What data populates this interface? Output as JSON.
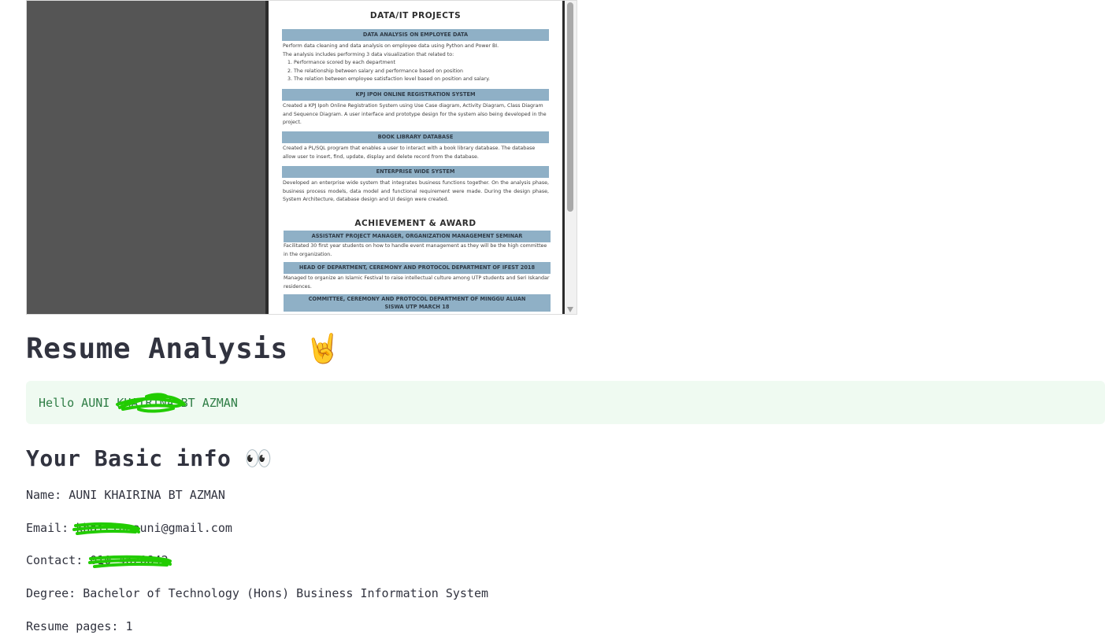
{
  "pdf": {
    "projects_title": "DATA/IT  PROJECTS",
    "p1": {
      "heading": "DATA ANALYSIS ON EMPLOYEE DATA",
      "line1": "Perform data cleaning and data analysis on employee data using Python and Power BI.",
      "line2": "The analysis includes performing 3 data visualization that related to:",
      "items": [
        "1. Performance scored by each department",
        "2. The relationship between salary and performance based on position",
        "3. The relation between employee satisfaction level based on position and salary."
      ]
    },
    "p2": {
      "heading": "KPJ IPOH ONLINE REGISTRATION SYSTEM",
      "text": "Created a KPJ Ipoh Online Registration System using Use Case diagram, Activity Diagram, Class Diagram and Sequence Diagram. A user interface and prototype design for the system also being developed in the project."
    },
    "p3": {
      "heading": "BOOK LIBRARY DATABASE",
      "text": "Created a PL/SQL program that enables a user to interact with a book library database. The database allow user to insert, find, update, display and delete record from the database."
    },
    "p4": {
      "heading": "ENTERPRISE WIDE SYSTEM",
      "text": "Developed an enterprise wide system that integrates business functions together. On the analysis phase, business process models, data model and functional requirement were made. During the design phase, System Architecture, database design and UI design were created."
    },
    "award_title": "ACHIEVEMENT & AWARD",
    "a1": {
      "heading": "ASSISTANT PROJECT MANAGER, ORGANIZATION MANAGEMENT SEMINAR",
      "text": "Facilitated 30 first year students on how to  handle event management as they will be the high committee in the organization."
    },
    "a2": {
      "heading": "HEAD OF DEPARTMENT, CEREMONY AND PROTOCOL DEPARTMENT OF IFEST 2018",
      "text": "Managed to organize an Islamic Festival to raise intellectual culture among UTP students and Seri Iskandar residences."
    },
    "a3": {
      "heading_line1": "COMMITTEE, CEREMONY AND PROTOCOL DEPARTMENT OF MINGGU ALUAN",
      "heading_line2": "SISWA UTP MARCH 18"
    }
  },
  "main": {
    "title": "Resume Analysis",
    "title_emoji": "🤘",
    "hello_prefix": "Hello AUNI ",
    "hello_hidden": "KHAIRINA",
    "hello_suffix": " BT AZMAN",
    "basic_title": "Your Basic info",
    "basic_emoji": "👀",
    "name_label": "Name: ",
    "name_value": "AUNI KHAIRINA BT AZMAN",
    "email_label": "Email: ",
    "email_hidden": "khairina",
    "email_suffix": "auni@gmail.com",
    "contact_label": "Contact: ",
    "contact_value": "010-4620842",
    "degree_label": "Degree: ",
    "degree_value": "Bachelor of Technology (Hons) Business Information System",
    "pages_label": "Resume pages: ",
    "pages_value": "1"
  },
  "colors": {
    "scribble": "#22cc00",
    "hello_bg": "#effaf1",
    "hello_text": "#2e7d45",
    "pdf_bar": "#8fb0c6"
  }
}
